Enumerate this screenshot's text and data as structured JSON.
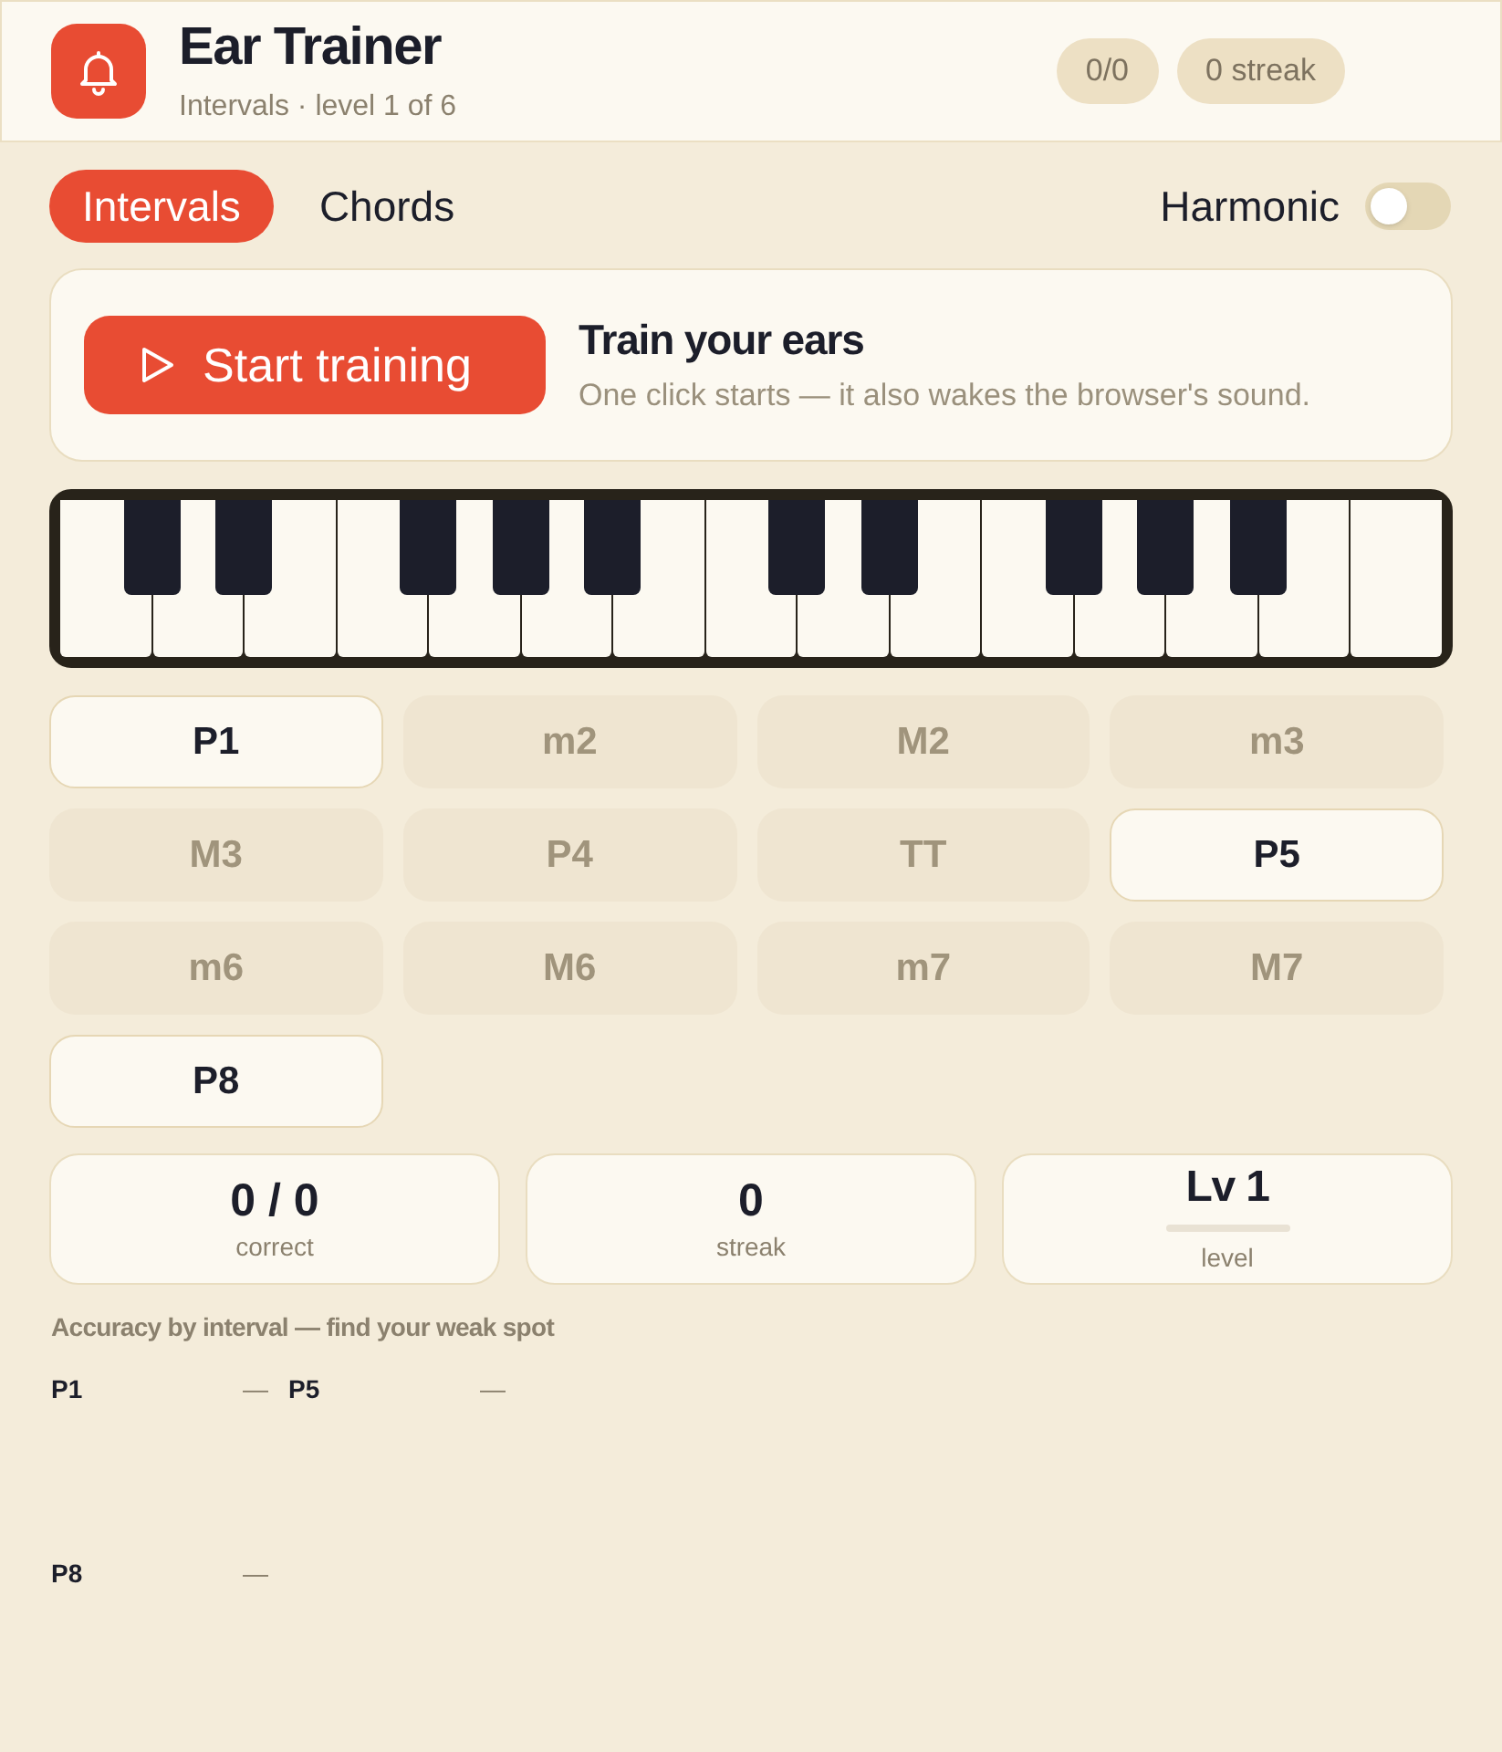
{
  "header": {
    "title": "Ear Trainer",
    "subtitle": "Intervals · level 1 of 6",
    "pills": [
      "0/0",
      "0 streak"
    ]
  },
  "modes": {
    "tabs": [
      {
        "label": "Intervals",
        "selected": true
      },
      {
        "label": "Chords",
        "selected": false
      }
    ],
    "harmonic": {
      "label": "Harmonic",
      "on": false
    }
  },
  "start_card": {
    "button": "Start training",
    "title": "Train your ears",
    "description": "One click starts — it also wakes the browser's sound."
  },
  "intervals": [
    {
      "label": "P1",
      "enabled": true
    },
    {
      "label": "m2",
      "enabled": false
    },
    {
      "label": "M2",
      "enabled": false
    },
    {
      "label": "m3",
      "enabled": false
    },
    {
      "label": "M3",
      "enabled": false
    },
    {
      "label": "P4",
      "enabled": false
    },
    {
      "label": "TT",
      "enabled": false
    },
    {
      "label": "P5",
      "enabled": true
    },
    {
      "label": "m6",
      "enabled": false
    },
    {
      "label": "M6",
      "enabled": false
    },
    {
      "label": "m7",
      "enabled": false
    },
    {
      "label": "M7",
      "enabled": false
    },
    {
      "label": "P8",
      "enabled": true
    }
  ],
  "stats": [
    {
      "kind": "count",
      "value": "0 / 0",
      "label": "correct"
    },
    {
      "kind": "count",
      "value": "0",
      "label": "streak"
    },
    {
      "kind": "level",
      "value": "Lv 1",
      "level": 0,
      "label": "level"
    }
  ],
  "accuracy": {
    "title": "Accuracy by interval — find your weak spot",
    "items": [
      {
        "label": "P1",
        "value": "—"
      },
      {
        "label": "P5",
        "value": "—"
      },
      {
        "label": "P8",
        "value": "—"
      }
    ]
  }
}
